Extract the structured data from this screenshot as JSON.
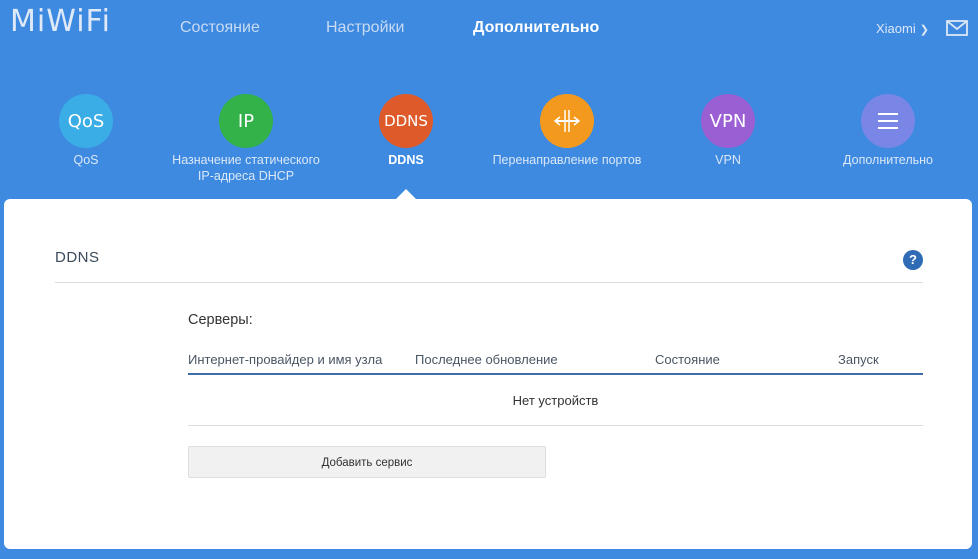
{
  "header": {
    "logo": "MiWiFi",
    "nav": [
      {
        "label": "Состояние"
      },
      {
        "label": "Настройки"
      },
      {
        "label": "Дополнительно"
      }
    ],
    "user": "Xiaomi"
  },
  "apps": [
    {
      "icon_text": "QoS",
      "label": "QoS",
      "color": "#3aace6"
    },
    {
      "icon_text": "IP",
      "label_line1": "Назначение статического",
      "label_line2": "IP-адреса DHCP",
      "color": "#33b24a"
    },
    {
      "icon_text": "DDNS",
      "label": "DDNS",
      "color": "#de5a2a"
    },
    {
      "icon_text": "",
      "icon_name": "port-forward-icon",
      "label": "Перенаправление портов",
      "color": "#f39a1e"
    },
    {
      "icon_text": "VPN",
      "label": "VPN",
      "color": "#9b5fd4"
    },
    {
      "icon_text": "",
      "icon_name": "menu-icon",
      "label": "Дополнительно",
      "color": "#7a86e6"
    }
  ],
  "panel": {
    "title": "DDNS",
    "help": "?",
    "servers_label": "Серверы:",
    "columns": [
      "Интернет-провайдер и имя узла",
      "Последнее обновление",
      "Состояние",
      "Запуск"
    ],
    "empty_text": "Нет устройств",
    "add_button": "Добавить сервис"
  }
}
